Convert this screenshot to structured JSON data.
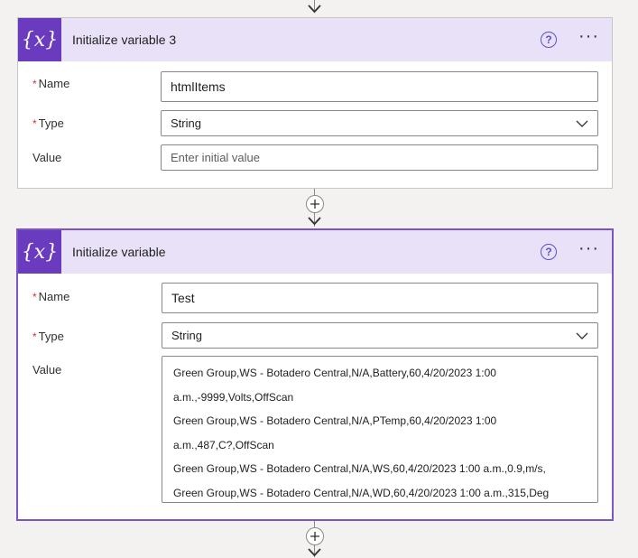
{
  "card1": {
    "title": "Initialize variable 3",
    "icon": "{x}",
    "name_label": "Name",
    "name_value": "htmlItems",
    "type_label": "Type",
    "type_value": "String",
    "value_label": "Value",
    "value_placeholder": "Enter initial value"
  },
  "card2": {
    "title": "Initialize variable",
    "icon": "{x}",
    "name_label": "Name",
    "name_value": "Test",
    "type_label": "Type",
    "type_value": "String",
    "value_label": "Value",
    "value_lines": [
      "Green Group,WS - Botadero Central,N/A,Battery,60,4/20/2023 1:00",
      "a.m.,-9999,Volts,OffScan",
      "Green Group,WS - Botadero Central,N/A,PTemp,60,4/20/2023 1:00",
      "a.m.,487,C?,OffScan",
      "Green Group,WS - Botadero Central,N/A,WS,60,4/20/2023 1:00 a.m.,0.9,m/s,",
      "Green Group,WS - Botadero Central,N/A,WD,60,4/20/2023 1:00 a.m.,315,Deg"
    ]
  },
  "required_mark": "*",
  "help_icon_glyph": "?",
  "more_icon_glyph": "···",
  "colors": {
    "header_bg": "#e8e1f7",
    "icon_bg": "#6b3bbf",
    "selected_border": "#7b55c8"
  }
}
